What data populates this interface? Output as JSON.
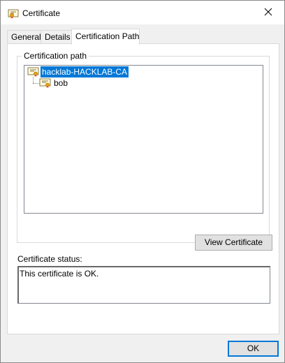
{
  "window": {
    "title": "Certificate",
    "icon": "certificate-icon",
    "close_icon": "close-icon"
  },
  "tabs": [
    {
      "label": "General",
      "active": false
    },
    {
      "label": "Details",
      "active": false
    },
    {
      "label": "Certification Path",
      "active": true
    }
  ],
  "certification_path": {
    "group_label": "Certification path",
    "nodes": [
      {
        "label": "hacklab-HACKLAB-CA",
        "selected": true,
        "icon": "certificate-icon"
      },
      {
        "label": "bob",
        "selected": false,
        "icon": "certificate-icon"
      }
    ],
    "view_button_label": "View Certificate"
  },
  "status": {
    "label": "Certificate status:",
    "text": "This certificate is OK."
  },
  "footer": {
    "ok_label": "OK"
  },
  "colors": {
    "selection": "#0078d7",
    "dialog_bg": "#f0f0f0",
    "button_bg": "#e1e1e1"
  }
}
